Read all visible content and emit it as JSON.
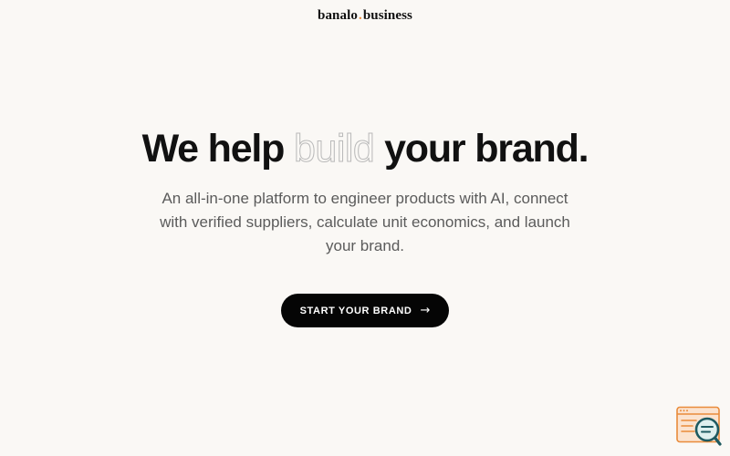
{
  "header": {
    "logo_left": "banalo",
    "logo_dot": ".",
    "logo_right": "business"
  },
  "hero": {
    "headline_before": "We help ",
    "headline_outline": "build",
    "headline_after": " your brand.",
    "subtitle": "An all-in-one platform to engineer products with AI, connect with verified suppliers, calculate unit economics, and launch your brand."
  },
  "cta": {
    "label": "START YOUR BRAND",
    "icon": "arrow-right-icon"
  },
  "widget": {
    "icon": "search-chat-widget-icon"
  },
  "colors": {
    "background": "#faf8f5",
    "text": "#111111",
    "muted_text": "#5b5b5b",
    "outline_text": "#b9b9b9",
    "button_bg": "#050505",
    "accent": "#e98b3a",
    "widget_teal": "#1e5a60"
  }
}
